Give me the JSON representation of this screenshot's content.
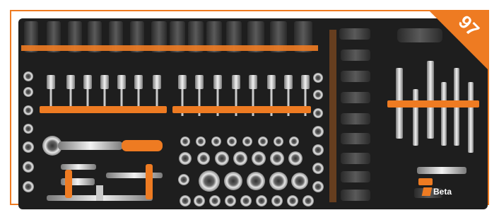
{
  "badge": {
    "number": "97"
  },
  "brand": {
    "logo_text": "Beta"
  },
  "colors": {
    "accent": "#ee7b22",
    "tray": "#1e1e1e",
    "chrome": "#c9c9c9",
    "white": "#ffffff"
  }
}
